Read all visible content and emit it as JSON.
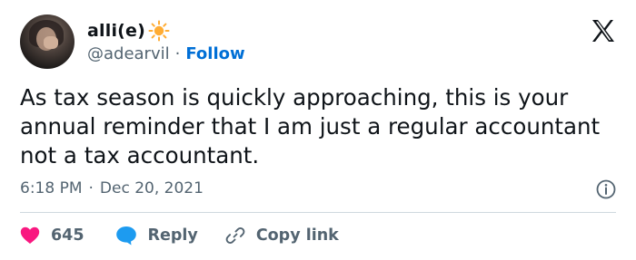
{
  "author": {
    "display_name": "alli(e)",
    "emoji_icon": "sun-icon",
    "handle": "@adearvil",
    "separator": "·",
    "follow_label": "Follow"
  },
  "logo_icon": "x-logo-icon",
  "tweet": {
    "text": "As tax season is quickly approaching, this is your annual reminder that I am just a regular accountant not a tax accountant.",
    "time": "6:18 PM",
    "separator": "·",
    "date": "Dec 20, 2021"
  },
  "actions": {
    "like_count": "645",
    "reply_label": "Reply",
    "copy_link_label": "Copy link"
  },
  "colors": {
    "text": "#0f1419",
    "secondary": "#536471",
    "link": "#006fd6",
    "like": "#f91880",
    "reply_icon": "#1d9bf0",
    "sun": "#ffac33",
    "divider": "#cfd9de"
  }
}
